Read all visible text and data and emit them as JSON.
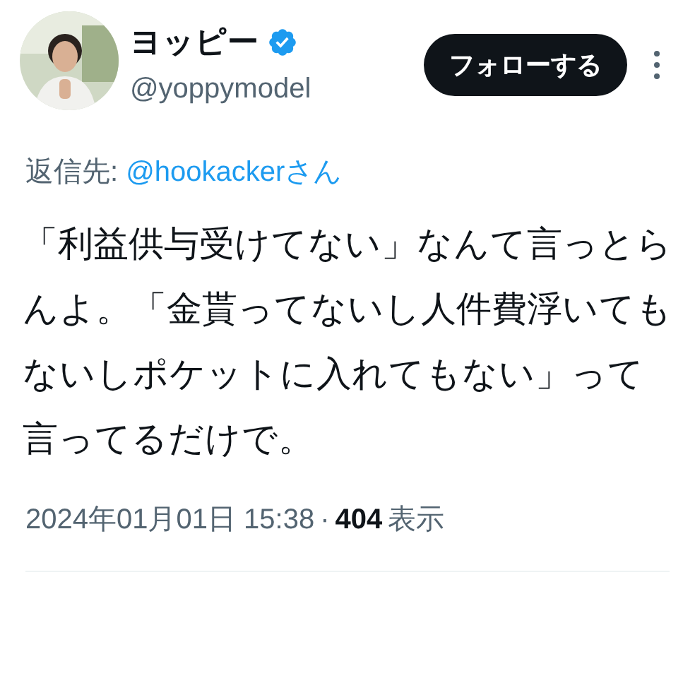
{
  "author": {
    "name": "ヨッピー",
    "verified": true,
    "handle": "@yoppymodel"
  },
  "follow_button": "フォローする",
  "reply_to": {
    "label": "返信先: ",
    "user": "@hookackerさん"
  },
  "body": "「利益供与受けてない」なんて言っとらんよ。「金貰ってないし人件費浮いてもないしポケットに入れてもない」って言ってるだけで。",
  "meta": {
    "timestamp": "2024年01月01日 15:38",
    "separator": "·",
    "views": "404",
    "views_label": "表示"
  }
}
